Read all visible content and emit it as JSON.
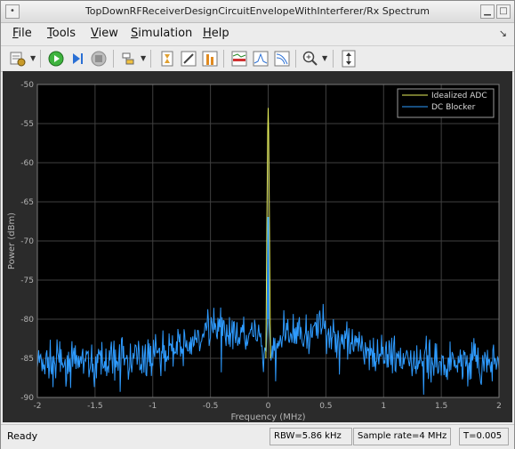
{
  "window": {
    "title": "TopDownRFReceiverDesignCircuitEnvelopeWithInterferer/Rx Spectrum"
  },
  "menu": [
    {
      "mnemonic": "F",
      "rest": "ile"
    },
    {
      "mnemonic": "T",
      "rest": "ools"
    },
    {
      "mnemonic": "V",
      "rest": "iew"
    },
    {
      "mnemonic": "S",
      "rest": "imulation"
    },
    {
      "mnemonic": "H",
      "rest": "elp"
    }
  ],
  "toolbar_icons": [
    "settings-icon",
    "run-icon",
    "step-forward-icon",
    "stop-icon",
    "highlight-icon",
    "axis-scale-icon",
    "edit-icon",
    "peak-icon",
    "spectrum-icon",
    "cursor-icon",
    "channel-icon",
    "zoom-in-icon",
    "fit-icon"
  ],
  "colors": {
    "series1": "#e8f15b",
    "series2": "#2e9bff",
    "plot_bg": "#000000",
    "frame_bg": "#2b2b2b",
    "grid": "#404040",
    "axis_text": "#b4b4b4"
  },
  "status": {
    "ready": "Ready",
    "rbw": "RBW=5.86 kHz",
    "sample_rate": "Sample rate=4 MHz",
    "time": "T=0.005"
  },
  "chart_data": {
    "type": "line",
    "xlabel": "Frequency (MHz)",
    "ylabel": "Power (dBm)",
    "xlim": [
      -2,
      2
    ],
    "ylim": [
      -90,
      -50
    ],
    "xticks": [
      -2,
      -1.5,
      -1,
      -0.5,
      0,
      0.5,
      1,
      1.5,
      2
    ],
    "xtick_labels": [
      "-2",
      "-1.5",
      "-1",
      "-0.5",
      "0",
      "0.5",
      "1",
      "1.5",
      "2"
    ],
    "yticks": [
      -50,
      -55,
      -60,
      -65,
      -70,
      -75,
      -80,
      -85,
      -90
    ],
    "ytick_labels": [
      "-50",
      "-55",
      "-60",
      "-65",
      "-70",
      "-75",
      "-80",
      "-85",
      "-90"
    ],
    "grid": true,
    "legend_position": "top-right",
    "series": [
      {
        "name": "Idealized ADC",
        "color": "#e8f15b",
        "points": [
          [
            -0.02,
            -85
          ],
          [
            -0.012,
            -70
          ],
          [
            -0.008,
            -62
          ],
          [
            -0.004,
            -56
          ],
          [
            0,
            -53
          ],
          [
            0.004,
            -56
          ],
          [
            0.008,
            -62
          ],
          [
            0.012,
            -70
          ],
          [
            0.02,
            -85
          ]
        ]
      },
      {
        "name": "DC Blocker",
        "color": "#2e9bff",
        "envelope": [
          [
            -2,
            -85.5
          ],
          [
            -1.5,
            -85.5
          ],
          [
            -1,
            -84.5
          ],
          [
            -0.7,
            -83.5
          ],
          [
            -0.55,
            -82
          ],
          [
            -0.5,
            -81
          ],
          [
            -0.3,
            -81.5
          ],
          [
            -0.1,
            -82.5
          ],
          [
            0,
            -84.5
          ],
          [
            0.1,
            -82.5
          ],
          [
            0.3,
            -81.5
          ],
          [
            0.5,
            -81
          ],
          [
            0.55,
            -82
          ],
          [
            0.7,
            -83.5
          ],
          [
            1,
            -84.5
          ],
          [
            1.5,
            -85.5
          ],
          [
            2,
            -85.5
          ]
        ],
        "peak": [
          [
            -0.006,
            -80
          ],
          [
            -0.002,
            -67
          ],
          [
            0,
            -67
          ],
          [
            0.002,
            -67
          ],
          [
            0.006,
            -80
          ]
        ]
      }
    ]
  }
}
